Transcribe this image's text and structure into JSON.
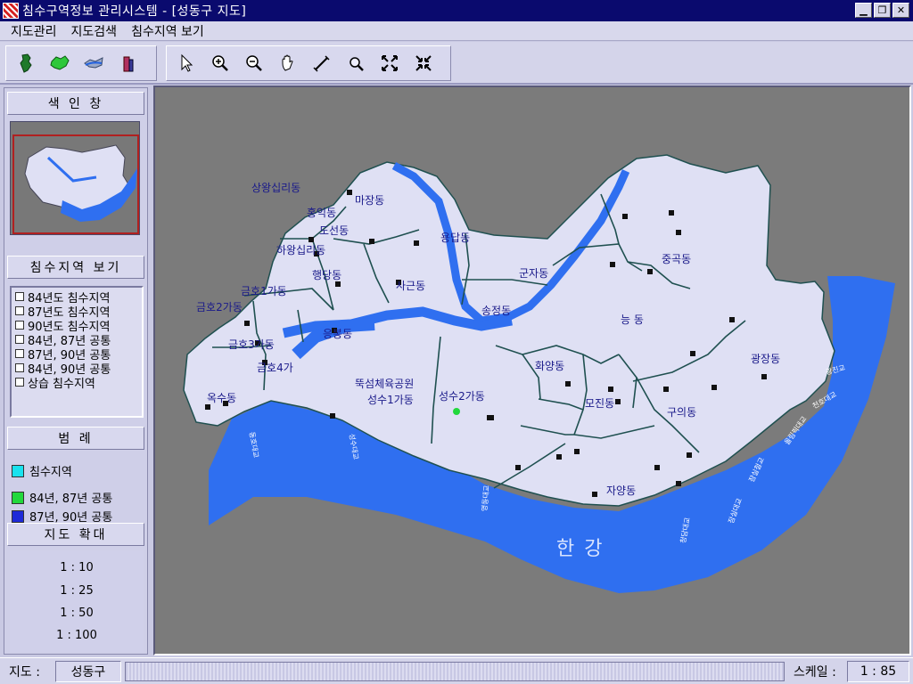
{
  "window": {
    "title": "침수구역정보 관리시스템 - [성동구 지도]"
  },
  "menu": [
    "지도관리",
    "지도검색",
    "침수지역 보기"
  ],
  "toolbar": {
    "layer_buttons": [
      "korea-map-icon",
      "seoul-map-icon",
      "river-layer-icon",
      "building-icon"
    ],
    "tool_buttons": [
      "pointer-icon",
      "zoom-in-icon",
      "zoom-out-icon",
      "pan-hand-icon",
      "measure-icon",
      "search-magnifier-icon",
      "full-extent-icon",
      "shrink-icon"
    ]
  },
  "sidebar": {
    "index_title": "색 인 창",
    "flood_title": "침수지역 보기",
    "layers": [
      "84년도 침수지역",
      "87년도 침수지역",
      "90년도 침수지역",
      "84년, 87년 공통",
      "87년, 90년 공통",
      "84년, 90년 공통",
      "상습 침수지역"
    ],
    "legend_title": "범     례",
    "legend": [
      {
        "label": "침수지역",
        "color": "#19e2ee"
      },
      {
        "label": "84년, 87년 공통",
        "color": "#22d83c"
      },
      {
        "label": "87년, 90년 공통",
        "color": "#1e2ad8"
      }
    ],
    "zoom_title": "지도 확대",
    "zoom_levels": [
      "1 : 10",
      "1 : 25",
      "1 : 50",
      "1 : 100"
    ]
  },
  "map": {
    "district_labels": [
      "상왕십리동",
      "마장동",
      "홍익동",
      "도선동",
      "하왕십리동",
      "용답동",
      "행당동",
      "사근동",
      "군자동",
      "금호1가동",
      "금호2가동",
      "송정동",
      "응봉동",
      "금호3가동",
      "금호4가",
      "능 동",
      "중곡동",
      "광장동",
      "화양동",
      "뚝섬체육공원",
      "성수1가동",
      "성수2가동",
      "모진동",
      "구의동",
      "옥수동",
      "자양동"
    ],
    "river_label": "한   강",
    "bridge_labels": [
      "동호대교",
      "성수대교",
      "영동대교",
      "청담대교",
      "잠실대교",
      "잠실철교",
      "올림픽대교",
      "천호대교",
      "광진교"
    ],
    "colors": {
      "land": "#dfe0f4",
      "water": "#2f6ff0",
      "boundary": "#1f5050",
      "background": "#7b7b7b"
    }
  },
  "status": {
    "map_label": "지도 :",
    "map_value": "성동구",
    "scale_label": "스케일 :",
    "scale_value": "1 : 85"
  }
}
